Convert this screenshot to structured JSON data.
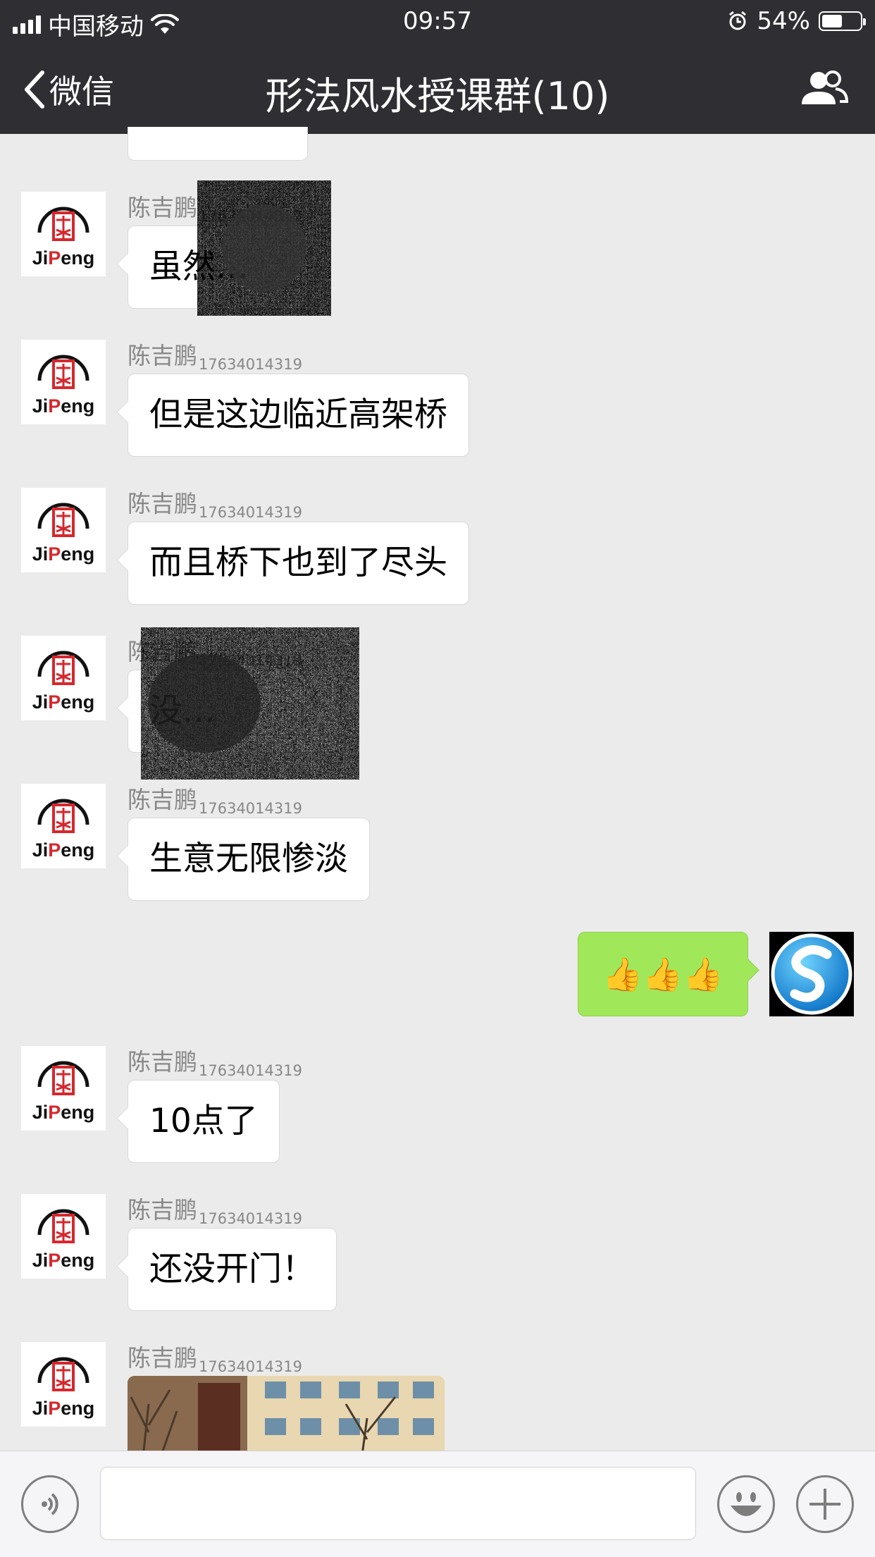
{
  "status_bar": {
    "carrier": "中国移动",
    "time": "09:57",
    "battery": "54%",
    "battery_level": 0.54
  },
  "nav": {
    "back_label": "微信",
    "title": "形法风水授课群(10)"
  },
  "avatar": {
    "logo_text": "JiPeng",
    "logo_text_a": "Ji",
    "logo_text_b": "P",
    "logo_text_c": "eng"
  },
  "messages": [
    {
      "sender": "陈吉鹏",
      "sender_id": "17634014319",
      "text": "虽然…"
    },
    {
      "sender": "陈吉鹏",
      "sender_id": "17634014319",
      "text": "但是这边临近高架桥"
    },
    {
      "sender": "陈吉鹏",
      "sender_id": "17634014319",
      "text": "而且桥下也到了尽头"
    },
    {
      "sender": "陈吉鹏",
      "sender_id": "17634014319",
      "text": "没…"
    },
    {
      "sender": "陈吉鹏",
      "sender_id": "17634014319",
      "text": "生意无限惨淡"
    },
    {
      "sender": "me",
      "text": "👍👍👍"
    },
    {
      "sender": "陈吉鹏",
      "sender_id": "17634014319",
      "text": "10点了"
    },
    {
      "sender": "陈吉鹏",
      "sender_id": "17634014319",
      "text": "还没开门！"
    },
    {
      "sender": "陈吉鹏",
      "sender_id": "17634014319",
      "image": "photo-of-building"
    }
  ],
  "icons": {
    "signal": "signal-bars-icon",
    "wifi": "wifi-icon",
    "alarm": "alarm-icon",
    "battery": "battery-icon",
    "back": "chevron-left-icon",
    "members": "group-members-icon",
    "voice": "voice-icon",
    "emoji": "emoji-icon",
    "plus": "plus-icon"
  },
  "colors": {
    "nav_bg": "#2e2e33",
    "chat_bg": "#ebebeb",
    "my_bubble": "#a0e75a",
    "logo_red": "#d6272d"
  }
}
